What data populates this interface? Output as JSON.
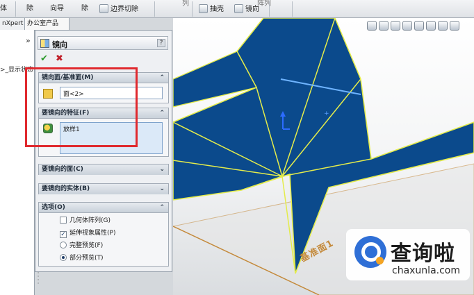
{
  "toolbar": {
    "items": [
      {
        "label": "体",
        "icon": "body-icon"
      },
      {
        "label": "除",
        "icon": "remove-icon"
      },
      {
        "label": "向导",
        "icon": "wizard-icon"
      },
      {
        "label": "除",
        "icon": "remove-icon"
      },
      {
        "label": "边界切除",
        "icon": "boundary-cut-icon"
      },
      {
        "label": "抽壳",
        "icon": "shell-icon"
      },
      {
        "label": "镜向",
        "icon": "mirror-icon"
      }
    ],
    "faded": [
      "列",
      "阵列"
    ]
  },
  "left_tabs": [
    "nXpert",
    "办公室产品"
  ],
  "tree": {
    "expand_glyph": "»",
    "item": ">_显示状态"
  },
  "property_manager": {
    "title": "镜向",
    "help_label": "?",
    "ok_glyph": "✔",
    "cancel_glyph": "✖",
    "groups": [
      {
        "title": "镜向面/基准面(M)",
        "expanded": true,
        "selection": "面<2>"
      },
      {
        "title": "要镜向的特征(F)",
        "expanded": true,
        "selection": "放样1"
      },
      {
        "title": "要镜向的面(C)",
        "expanded": false
      },
      {
        "title": "要镜向的实体(B)",
        "expanded": false
      },
      {
        "title": "选项(O)",
        "expanded": true
      }
    ],
    "options": [
      {
        "label": "几何体阵列(G)",
        "type": "checkbox",
        "checked": false
      },
      {
        "label": "延伸视象属性(P)",
        "type": "checkbox",
        "checked": true
      },
      {
        "label": "完整预览(F)",
        "type": "radio",
        "checked": false
      },
      {
        "label": "部分预览(T)",
        "type": "radio",
        "checked": true
      }
    ],
    "chevron_up": "⌃",
    "chevron_down": "⌄"
  },
  "viewport": {
    "plane_label": "基准面1",
    "colors": {
      "part": "#0b4a8c",
      "edge": "#e4ec4b",
      "plane": "#c48a3c"
    }
  },
  "watermark": {
    "name_cn": "查询啦",
    "domain": "chaxunla.com"
  },
  "annotation": {
    "color": "#e0292e"
  }
}
